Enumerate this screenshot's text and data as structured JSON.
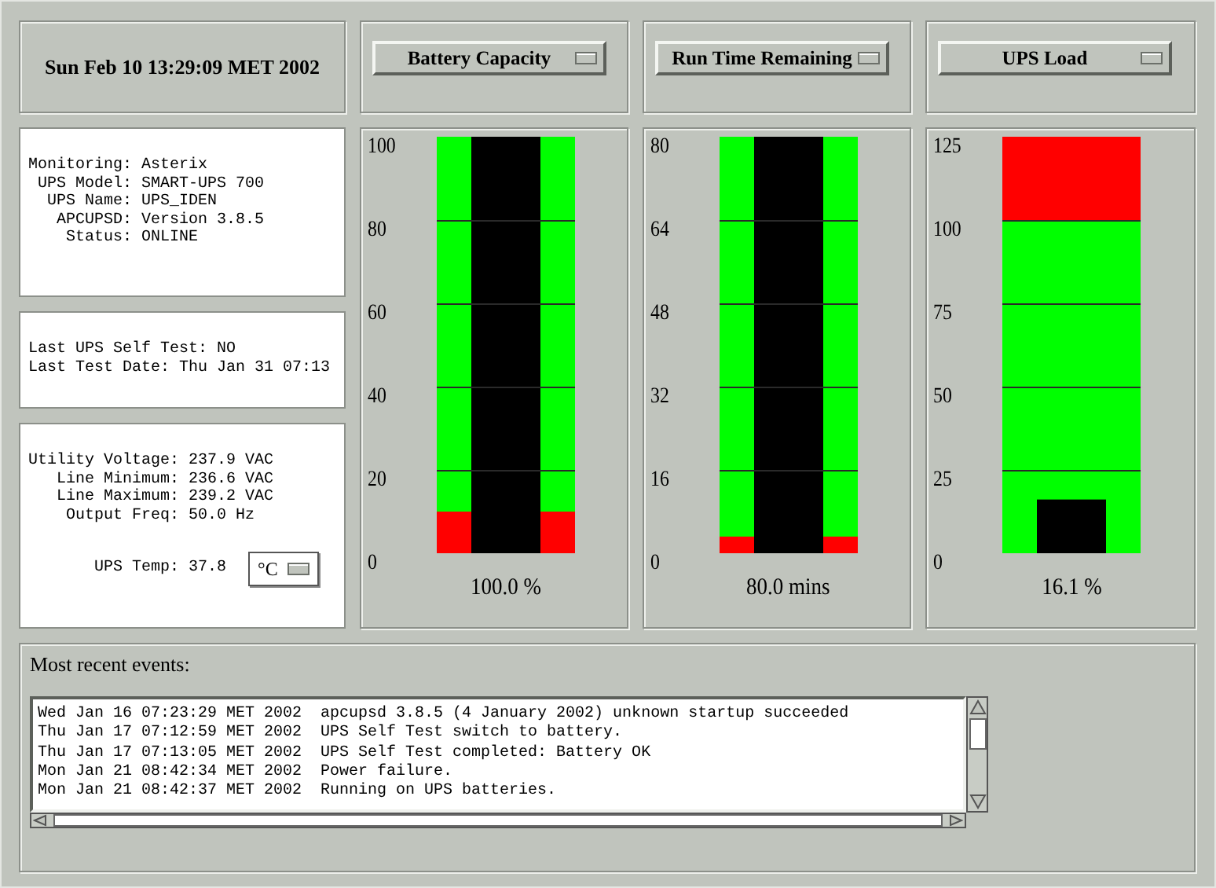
{
  "clock": "Sun Feb 10 13:29:09 MET 2002",
  "status_box": {
    "rows": [
      {
        "label": "Monitoring:",
        "value": "Asterix"
      },
      {
        "label": "UPS Model:",
        "value": "SMART-UPS 700"
      },
      {
        "label": "UPS Name:",
        "value": "UPS_IDEN"
      },
      {
        "label": "APCUPSD:",
        "value": "Version 3.8.5"
      },
      {
        "label": "Status:",
        "value": "ONLINE"
      }
    ]
  },
  "self_test_box": {
    "lines": [
      "Last UPS Self Test: NO",
      "Last Test Date: Thu Jan 31 07:13"
    ]
  },
  "power_box": {
    "rows": [
      {
        "label": "Utility Voltage:",
        "value": "237.9 VAC"
      },
      {
        "label": "Line Minimum:",
        "value": "236.6 VAC"
      },
      {
        "label": "Line Maximum:",
        "value": "239.2 VAC"
      },
      {
        "label": "Output Freq:",
        "value": "50.0 Hz"
      }
    ],
    "temperature": {
      "label": "UPS Temp:",
      "value": "37.8",
      "unit": "°C"
    }
  },
  "gauges": [
    {
      "selector": "Battery Capacity",
      "ticks": [
        "100",
        "80",
        "60",
        "40",
        "20",
        "0"
      ],
      "kind": "minimum",
      "level": 1.0,
      "alarm_zone": {
        "level": 0.1
      },
      "reading": "100.0 %"
    },
    {
      "selector": "Run Time Remaining",
      "ticks": [
        "80",
        "64",
        "48",
        "32",
        "16",
        "0"
      ],
      "kind": "minimum",
      "level": 1.0,
      "alarm_zone": {
        "level": 0.04
      },
      "reading": "80.0 mins"
    },
    {
      "selector": "UPS Load",
      "ticks": [
        "125",
        "100",
        "75",
        "50",
        "25",
        "0"
      ],
      "kind": "maximum",
      "level": 0.129,
      "alarm_zone": {
        "level": 0.2
      },
      "reading": "16.1 %"
    }
  ],
  "events": {
    "title": "Most recent events:",
    "lines": [
      "Wed Jan 16 07:23:29 MET 2002  apcupsd 3.8.5 (4 January 2002) unknown startup succeeded",
      "Thu Jan 17 07:12:59 MET 2002  UPS Self Test switch to battery.",
      "Thu Jan 17 07:13:05 MET 2002  UPS Self Test completed: Battery OK",
      "Mon Jan 21 08:42:34 MET 2002  Power failure.",
      "Mon Jan 21 08:42:37 MET 2002  Running on UPS batteries."
    ]
  }
}
